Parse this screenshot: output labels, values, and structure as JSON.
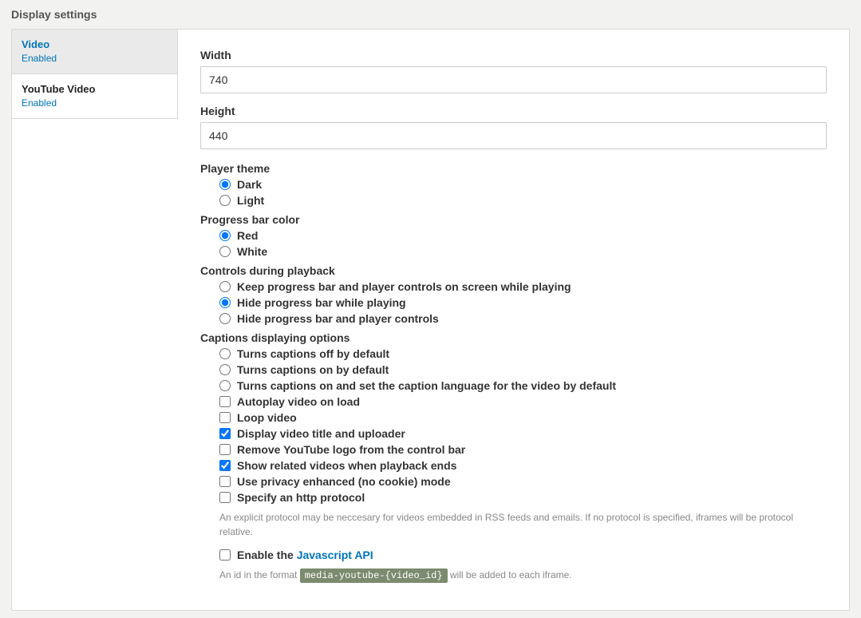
{
  "header": {
    "title": "Display settings"
  },
  "tabs": [
    {
      "title": "Video",
      "sub": "Enabled",
      "selected": true
    },
    {
      "title": "YouTube Video",
      "sub": "Enabled",
      "selected": false
    }
  ],
  "fields": {
    "width": {
      "label": "Width",
      "value": "740"
    },
    "height": {
      "label": "Height",
      "value": "440"
    }
  },
  "groups": {
    "player_theme": {
      "label": "Player theme",
      "options": [
        {
          "label": "Dark",
          "checked": true
        },
        {
          "label": "Light",
          "checked": false
        }
      ]
    },
    "progress_bar_color": {
      "label": "Progress bar color",
      "options": [
        {
          "label": "Red",
          "checked": true
        },
        {
          "label": "White",
          "checked": false
        }
      ]
    },
    "controls_playback": {
      "label": "Controls during playback",
      "options": [
        {
          "label": "Keep progress bar and player controls on screen while playing",
          "checked": false
        },
        {
          "label": "Hide progress bar while playing",
          "checked": true
        },
        {
          "label": "Hide progress bar and player controls",
          "checked": false
        }
      ]
    },
    "captions": {
      "label": "Captions displaying options",
      "options": [
        {
          "label": "Turns captions off by default",
          "checked": false
        },
        {
          "label": "Turns captions on by default",
          "checked": false
        },
        {
          "label": "Turns captions on and set the caption language for the video by default",
          "checked": false
        }
      ]
    }
  },
  "checkboxes": {
    "autoplay": {
      "label": "Autoplay video on load",
      "checked": false
    },
    "loop": {
      "label": "Loop video",
      "checked": false
    },
    "display_title": {
      "label": "Display video title and uploader",
      "checked": true
    },
    "remove_logo": {
      "label": "Remove YouTube logo from the control bar",
      "checked": false
    },
    "related": {
      "label": "Show related videos when playback ends",
      "checked": true
    },
    "privacy": {
      "label": "Use privacy enhanced (no cookie) mode",
      "checked": false
    },
    "http": {
      "label": "Specify an http protocol",
      "checked": false
    },
    "http_help": "An explicit protocol may be neccesary for videos embedded in RSS feeds and emails. If no protocol is specified, iframes will be protocol relative.",
    "jsapi": {
      "label_prefix": "Enable the ",
      "label_link": "Javascript API",
      "checked": false
    },
    "jsapi_help_prefix": "An id in the format ",
    "jsapi_help_code": "media-youtube-{video_id}",
    "jsapi_help_suffix": " will be added to each iframe."
  }
}
